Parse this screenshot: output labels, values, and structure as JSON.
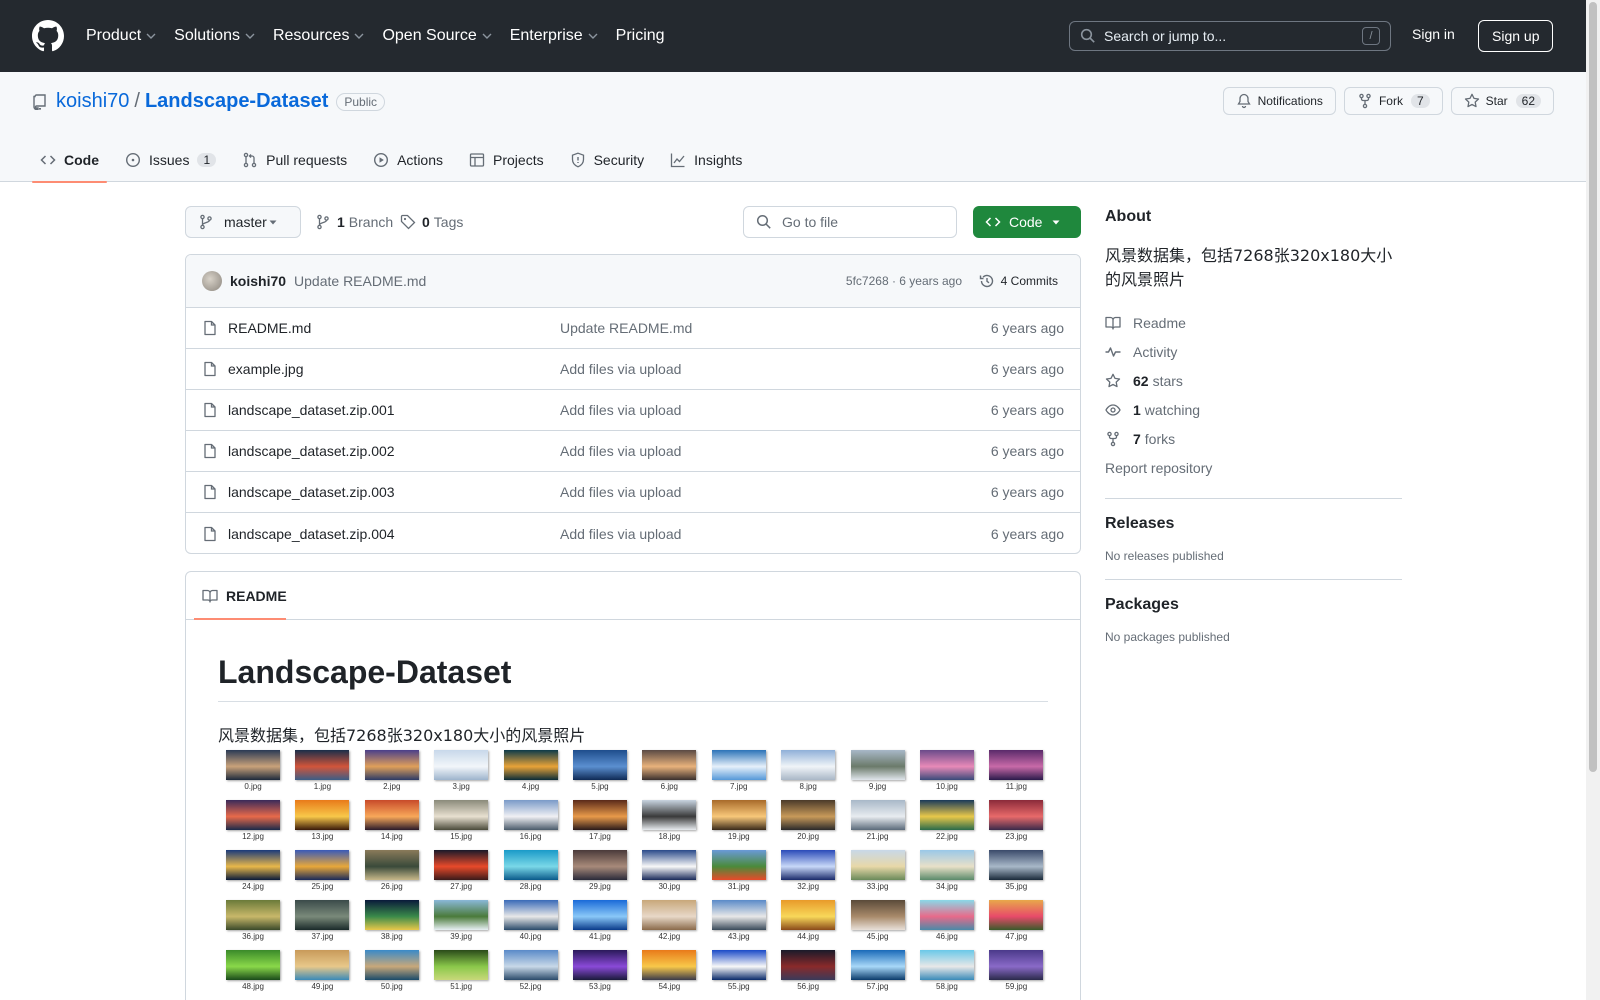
{
  "header": {
    "nav": [
      "Product",
      "Solutions",
      "Resources",
      "Open Source",
      "Enterprise",
      "Pricing"
    ],
    "search_placeholder": "Search or jump to...",
    "search_shortcut": "/",
    "signin": "Sign in",
    "signup": "Sign up"
  },
  "repo": {
    "owner": "koishi70",
    "separator": "/",
    "name": "Landscape-Dataset",
    "visibility": "Public",
    "notifications": "Notifications",
    "fork_label": "Fork",
    "fork_count": "7",
    "star_label": "Star",
    "star_count": "62"
  },
  "tabs": [
    {
      "label": "Code",
      "icon": "code-icon",
      "active": true
    },
    {
      "label": "Issues",
      "icon": "issue-icon",
      "count": "1"
    },
    {
      "label": "Pull requests",
      "icon": "pull-request-icon"
    },
    {
      "label": "Actions",
      "icon": "play-icon"
    },
    {
      "label": "Projects",
      "icon": "table-icon"
    },
    {
      "label": "Security",
      "icon": "shield-icon"
    },
    {
      "label": "Insights",
      "icon": "graph-icon"
    }
  ],
  "toolbar": {
    "branch": "master",
    "branch_count": "1",
    "branch_label": "Branch",
    "tag_count": "0",
    "tag_label": "Tags",
    "goto_placeholder": "Go to file",
    "code_button": "Code"
  },
  "commit": {
    "author": "koishi70",
    "message": "Update README.md",
    "meta": "5fc7268 · 6 years ago",
    "commits": "4 Commits"
  },
  "files": [
    {
      "name": "README.md",
      "message": "Update README.md",
      "date": "6 years ago"
    },
    {
      "name": "example.jpg",
      "message": "Add files via upload",
      "date": "6 years ago"
    },
    {
      "name": "landscape_dataset.zip.001",
      "message": "Add files via upload",
      "date": "6 years ago"
    },
    {
      "name": "landscape_dataset.zip.002",
      "message": "Add files via upload",
      "date": "6 years ago"
    },
    {
      "name": "landscape_dataset.zip.003",
      "message": "Add files via upload",
      "date": "6 years ago"
    },
    {
      "name": "landscape_dataset.zip.004",
      "message": "Add files via upload",
      "date": "6 years ago"
    }
  ],
  "readme": {
    "tab_label": "README",
    "title": "Landscape-Dataset",
    "description": "风景数据集，包括7268张320x180大小的风景照片",
    "thumbnails": [
      {
        "caption": "0.jpg",
        "colors": [
          "#2a3a55",
          "#c9a27a",
          "#1d2a3c"
        ]
      },
      {
        "caption": "1.jpg",
        "colors": [
          "#1a2e4a",
          "#d2553a",
          "#3b5d86"
        ]
      },
      {
        "caption": "2.jpg",
        "colors": [
          "#4a3f8a",
          "#e0a05a",
          "#2c3a66"
        ]
      },
      {
        "caption": "3.jpg",
        "colors": [
          "#c8d8ea",
          "#f2f6fa",
          "#9db4cc"
        ]
      },
      {
        "caption": "4.jpg",
        "colors": [
          "#0d3b4a",
          "#e8a338",
          "#0a2c38"
        ]
      },
      {
        "caption": "5.jpg",
        "colors": [
          "#1e4d8c",
          "#5b8fd0",
          "#0f2a55"
        ]
      },
      {
        "caption": "6.jpg",
        "colors": [
          "#5a4a44",
          "#e8b27c",
          "#3a302e"
        ]
      },
      {
        "caption": "7.jpg",
        "colors": [
          "#2c73b8",
          "#e6f0fa",
          "#5598d8"
        ]
      },
      {
        "caption": "8.jpg",
        "colors": [
          "#8fb0d8",
          "#f0f4f8",
          "#a9b7c6"
        ]
      },
      {
        "caption": "9.jpg",
        "colors": [
          "#a8b8c8",
          "#6b7a6a",
          "#e0e6ec"
        ]
      },
      {
        "caption": "10.jpg",
        "colors": [
          "#6a4a8a",
          "#e88ab8",
          "#3a4a7a"
        ]
      },
      {
        "caption": "11.jpg",
        "colors": [
          "#5a2a6a",
          "#c86aa8",
          "#2a1a4a"
        ]
      },
      {
        "caption": "12.jpg",
        "colors": [
          "#3a2a5a",
          "#e86a4a",
          "#1a2a4a"
        ]
      },
      {
        "caption": "13.jpg",
        "colors": [
          "#e87a1a",
          "#f8c84a",
          "#3a1a0a"
        ]
      },
      {
        "caption": "14.jpg",
        "colors": [
          "#c84a2a",
          "#f8a85a",
          "#2a1a2a"
        ]
      },
      {
        "caption": "15.jpg",
        "colors": [
          "#8a8a7a",
          "#e8e0d0",
          "#4a4a3a"
        ]
      },
      {
        "caption": "16.jpg",
        "colors": [
          "#7a9ac8",
          "#f0f0f4",
          "#4a5a6a"
        ]
      },
      {
        "caption": "17.jpg",
        "colors": [
          "#5a2a1a",
          "#e89a4a",
          "#2a1a1a"
        ]
      },
      {
        "caption": "18.jpg",
        "colors": [
          "#c8d4e0",
          "#3a3a3a",
          "#e8ecf0"
        ]
      },
      {
        "caption": "19.jpg",
        "colors": [
          "#a86a2a",
          "#f8c87a",
          "#3a2a1a"
        ]
      },
      {
        "caption": "20.jpg",
        "colors": [
          "#4a3a2a",
          "#c89a5a",
          "#2a2a2a"
        ]
      },
      {
        "caption": "21.jpg",
        "colors": [
          "#a8b8c8",
          "#e8ecf0",
          "#5a6a7a"
        ]
      },
      {
        "caption": "22.jpg",
        "colors": [
          "#1a3a5a",
          "#e8c84a",
          "#2a6a4a"
        ]
      },
      {
        "caption": "23.jpg",
        "colors": [
          "#8a2a3a",
          "#e86a6a",
          "#3a2a4a"
        ]
      },
      {
        "caption": "24.jpg",
        "colors": [
          "#1a3a7a",
          "#e8b84a",
          "#0a1a3a"
        ]
      },
      {
        "caption": "25.jpg",
        "colors": [
          "#3a5ab8",
          "#e8a83a",
          "#1a2a5a"
        ]
      },
      {
        "caption": "26.jpg",
        "colors": [
          "#8a7a5a",
          "#3a4a3a",
          "#c8b88a"
        ]
      },
      {
        "caption": "27.jpg",
        "colors": [
          "#1a1a2a",
          "#e84a2a",
          "#3a1a1a"
        ]
      },
      {
        "caption": "28.jpg",
        "colors": [
          "#1a9ac8",
          "#7ad8e8",
          "#0a5a8a"
        ]
      },
      {
        "caption": "29.jpg",
        "colors": [
          "#4a3a3a",
          "#a88a7a",
          "#2a2a3a"
        ]
      },
      {
        "caption": "30.jpg",
        "colors": [
          "#2a4a8a",
          "#f8f8f8",
          "#1a2a5a"
        ]
      },
      {
        "caption": "31.jpg",
        "colors": [
          "#6a9ad8",
          "#4a8a3a",
          "#e84a2a"
        ]
      },
      {
        "caption": "32.jpg",
        "colors": [
          "#2a4ab8",
          "#c8d8f8",
          "#1a2a6a"
        ]
      },
      {
        "caption": "33.jpg",
        "colors": [
          "#c8d8e8",
          "#e8d8a8",
          "#6a8a5a"
        ]
      },
      {
        "caption": "34.jpg",
        "colors": [
          "#9ac8e8",
          "#e8e0c8",
          "#5a8a6a"
        ]
      },
      {
        "caption": "35.jpg",
        "colors": [
          "#3a4a6a",
          "#a8b8c8",
          "#1a2a3a"
        ]
      },
      {
        "caption": "36.jpg",
        "colors": [
          "#6a7a3a",
          "#c8b86a",
          "#3a4a2a"
        ]
      },
      {
        "caption": "37.jpg",
        "colors": [
          "#3a4a4a",
          "#7a8a7a",
          "#1a2a2a"
        ]
      },
      {
        "caption": "38.jpg",
        "colors": [
          "#0a1a3a",
          "#3a8a4a",
          "#e8c84a"
        ]
      },
      {
        "caption": "39.jpg",
        "colors": [
          "#8ab8d8",
          "#4a7a3a",
          "#e8f0f4"
        ]
      },
      {
        "caption": "40.jpg",
        "colors": [
          "#3a6ab8",
          "#e8e8e8",
          "#2a4a6a"
        ]
      },
      {
        "caption": "41.jpg",
        "colors": [
          "#1a6ad8",
          "#8ac8f8",
          "#0a3a8a"
        ]
      },
      {
        "caption": "42.jpg",
        "colors": [
          "#c8a87a",
          "#e8d8c8",
          "#8a6a4a"
        ]
      },
      {
        "caption": "43.jpg",
        "colors": [
          "#5a8ac8",
          "#e8e8e8",
          "#3a4a5a"
        ]
      },
      {
        "caption": "44.jpg",
        "colors": [
          "#e89a2a",
          "#f8d85a",
          "#8a4a1a"
        ]
      },
      {
        "caption": "45.jpg",
        "colors": [
          "#5a4a3a",
          "#a88a6a",
          "#e8e0d8"
        ]
      },
      {
        "caption": "46.jpg",
        "colors": [
          "#8ad8e8",
          "#e86a8a",
          "#4a8aa8"
        ]
      },
      {
        "caption": "47.jpg",
        "colors": [
          "#e8a84a",
          "#e84a6a",
          "#3a5a2a"
        ]
      },
      {
        "caption": "48.jpg",
        "colors": [
          "#3a8a2a",
          "#8ad84a",
          "#1a4a1a"
        ]
      },
      {
        "caption": "49.jpg",
        "colors": [
          "#c89a5a",
          "#e8c88a",
          "#3a8ab8"
        ]
      },
      {
        "caption": "50.jpg",
        "colors": [
          "#3a8ac8",
          "#c8a87a",
          "#1a4a6a"
        ]
      },
      {
        "caption": "51.jpg",
        "colors": [
          "#2a4a1a",
          "#8ac84a",
          "#c8d87a"
        ]
      },
      {
        "caption": "52.jpg",
        "colors": [
          "#5a8ac8",
          "#c8d8e8",
          "#2a4a6a"
        ]
      },
      {
        "caption": "53.jpg",
        "colors": [
          "#2a1a5a",
          "#8a4ad8",
          "#1a1a3a"
        ]
      },
      {
        "caption": "54.jpg",
        "colors": [
          "#e87a1a",
          "#f8c84a",
          "#3a3a4a"
        ]
      },
      {
        "caption": "55.jpg",
        "colors": [
          "#1a4ac8",
          "#f8f8f8",
          "#0a2a6a"
        ]
      },
      {
        "caption": "56.jpg",
        "colors": [
          "#1a1a2a",
          "#8a2a2a",
          "#3a3a5a"
        ]
      },
      {
        "caption": "57.jpg",
        "colors": [
          "#1a6ab8",
          "#a8d8f8",
          "#0a3a6a"
        ]
      },
      {
        "caption": "58.jpg",
        "colors": [
          "#6ac8e8",
          "#e8e8e8",
          "#3a8ab8"
        ]
      },
      {
        "caption": "59.jpg",
        "colors": [
          "#4a3a8a",
          "#8a6ac8",
          "#2a2a4a"
        ]
      }
    ]
  },
  "sidebar": {
    "about_title": "About",
    "description": "风景数据集，包括7268张320x180大小的风景照片",
    "readme": "Readme",
    "activity": "Activity",
    "stars_count": "62",
    "stars_label": "stars",
    "watching_count": "1",
    "watching_label": "watching",
    "forks_count": "7",
    "forks_label": "forks",
    "report": "Report repository",
    "releases_title": "Releases",
    "releases_empty": "No releases published",
    "packages_title": "Packages",
    "packages_empty": "No packages published"
  },
  "colors": {
    "header_bg": "#24292f",
    "link": "#0969da",
    "primary_green": "#1f883d",
    "tab_underline": "#fd8c73"
  }
}
